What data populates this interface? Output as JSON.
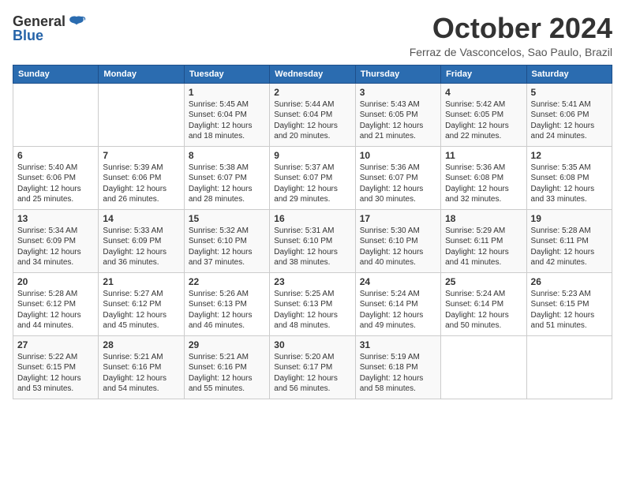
{
  "logo": {
    "line1": "General",
    "line2": "Blue"
  },
  "header": {
    "month": "October 2024",
    "location": "Ferraz de Vasconcelos, Sao Paulo, Brazil"
  },
  "weekdays": [
    "Sunday",
    "Monday",
    "Tuesday",
    "Wednesday",
    "Thursday",
    "Friday",
    "Saturday"
  ],
  "weeks": [
    [
      {
        "day": "",
        "info": ""
      },
      {
        "day": "",
        "info": ""
      },
      {
        "day": "1",
        "info": "Sunrise: 5:45 AM\nSunset: 6:04 PM\nDaylight: 12 hours\nand 18 minutes."
      },
      {
        "day": "2",
        "info": "Sunrise: 5:44 AM\nSunset: 6:04 PM\nDaylight: 12 hours\nand 20 minutes."
      },
      {
        "day": "3",
        "info": "Sunrise: 5:43 AM\nSunset: 6:05 PM\nDaylight: 12 hours\nand 21 minutes."
      },
      {
        "day": "4",
        "info": "Sunrise: 5:42 AM\nSunset: 6:05 PM\nDaylight: 12 hours\nand 22 minutes."
      },
      {
        "day": "5",
        "info": "Sunrise: 5:41 AM\nSunset: 6:06 PM\nDaylight: 12 hours\nand 24 minutes."
      }
    ],
    [
      {
        "day": "6",
        "info": "Sunrise: 5:40 AM\nSunset: 6:06 PM\nDaylight: 12 hours\nand 25 minutes."
      },
      {
        "day": "7",
        "info": "Sunrise: 5:39 AM\nSunset: 6:06 PM\nDaylight: 12 hours\nand 26 minutes."
      },
      {
        "day": "8",
        "info": "Sunrise: 5:38 AM\nSunset: 6:07 PM\nDaylight: 12 hours\nand 28 minutes."
      },
      {
        "day": "9",
        "info": "Sunrise: 5:37 AM\nSunset: 6:07 PM\nDaylight: 12 hours\nand 29 minutes."
      },
      {
        "day": "10",
        "info": "Sunrise: 5:36 AM\nSunset: 6:07 PM\nDaylight: 12 hours\nand 30 minutes."
      },
      {
        "day": "11",
        "info": "Sunrise: 5:36 AM\nSunset: 6:08 PM\nDaylight: 12 hours\nand 32 minutes."
      },
      {
        "day": "12",
        "info": "Sunrise: 5:35 AM\nSunset: 6:08 PM\nDaylight: 12 hours\nand 33 minutes."
      }
    ],
    [
      {
        "day": "13",
        "info": "Sunrise: 5:34 AM\nSunset: 6:09 PM\nDaylight: 12 hours\nand 34 minutes."
      },
      {
        "day": "14",
        "info": "Sunrise: 5:33 AM\nSunset: 6:09 PM\nDaylight: 12 hours\nand 36 minutes."
      },
      {
        "day": "15",
        "info": "Sunrise: 5:32 AM\nSunset: 6:10 PM\nDaylight: 12 hours\nand 37 minutes."
      },
      {
        "day": "16",
        "info": "Sunrise: 5:31 AM\nSunset: 6:10 PM\nDaylight: 12 hours\nand 38 minutes."
      },
      {
        "day": "17",
        "info": "Sunrise: 5:30 AM\nSunset: 6:10 PM\nDaylight: 12 hours\nand 40 minutes."
      },
      {
        "day": "18",
        "info": "Sunrise: 5:29 AM\nSunset: 6:11 PM\nDaylight: 12 hours\nand 41 minutes."
      },
      {
        "day": "19",
        "info": "Sunrise: 5:28 AM\nSunset: 6:11 PM\nDaylight: 12 hours\nand 42 minutes."
      }
    ],
    [
      {
        "day": "20",
        "info": "Sunrise: 5:28 AM\nSunset: 6:12 PM\nDaylight: 12 hours\nand 44 minutes."
      },
      {
        "day": "21",
        "info": "Sunrise: 5:27 AM\nSunset: 6:12 PM\nDaylight: 12 hours\nand 45 minutes."
      },
      {
        "day": "22",
        "info": "Sunrise: 5:26 AM\nSunset: 6:13 PM\nDaylight: 12 hours\nand 46 minutes."
      },
      {
        "day": "23",
        "info": "Sunrise: 5:25 AM\nSunset: 6:13 PM\nDaylight: 12 hours\nand 48 minutes."
      },
      {
        "day": "24",
        "info": "Sunrise: 5:24 AM\nSunset: 6:14 PM\nDaylight: 12 hours\nand 49 minutes."
      },
      {
        "day": "25",
        "info": "Sunrise: 5:24 AM\nSunset: 6:14 PM\nDaylight: 12 hours\nand 50 minutes."
      },
      {
        "day": "26",
        "info": "Sunrise: 5:23 AM\nSunset: 6:15 PM\nDaylight: 12 hours\nand 51 minutes."
      }
    ],
    [
      {
        "day": "27",
        "info": "Sunrise: 5:22 AM\nSunset: 6:15 PM\nDaylight: 12 hours\nand 53 minutes."
      },
      {
        "day": "28",
        "info": "Sunrise: 5:21 AM\nSunset: 6:16 PM\nDaylight: 12 hours\nand 54 minutes."
      },
      {
        "day": "29",
        "info": "Sunrise: 5:21 AM\nSunset: 6:16 PM\nDaylight: 12 hours\nand 55 minutes."
      },
      {
        "day": "30",
        "info": "Sunrise: 5:20 AM\nSunset: 6:17 PM\nDaylight: 12 hours\nand 56 minutes."
      },
      {
        "day": "31",
        "info": "Sunrise: 5:19 AM\nSunset: 6:18 PM\nDaylight: 12 hours\nand 58 minutes."
      },
      {
        "day": "",
        "info": ""
      },
      {
        "day": "",
        "info": ""
      }
    ]
  ]
}
